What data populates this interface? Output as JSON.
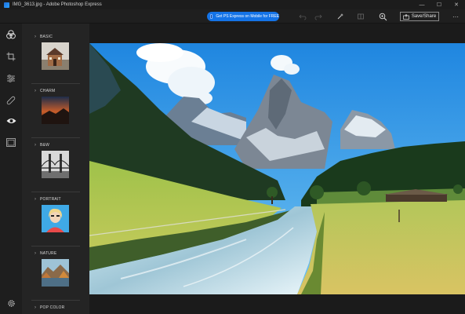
{
  "window": {
    "title": "IMG_3613.jpg - Adobe Photoshop Express",
    "controls": [
      "—",
      "☐",
      "✕"
    ]
  },
  "toolbar": {
    "promo_label": "Get PS Express on Mobile for FREE",
    "save_label": "Save/Share",
    "more_label": "···"
  },
  "filters": {
    "categories": [
      {
        "label": "BASIC"
      },
      {
        "label": "CHARM"
      },
      {
        "label": "B&W"
      },
      {
        "label": "PORTRAIT"
      },
      {
        "label": "NATURE"
      },
      {
        "label": "POP COLOR"
      }
    ]
  },
  "colors": {
    "accent": "#1473e6",
    "background": "#1b1b1b",
    "panel": "#242424"
  }
}
